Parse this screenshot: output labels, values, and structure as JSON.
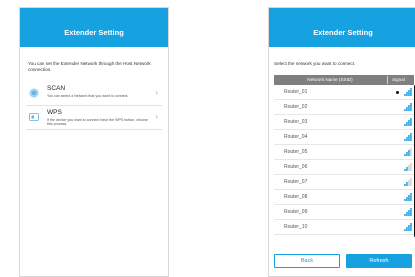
{
  "left_screen": {
    "title": "Extender Setting",
    "intro": "You can set the Extender Network through the Host Network connection.",
    "options": [
      {
        "title": "SCAN",
        "description": "You can select a Network that you want to connect.",
        "icon": "scan-icon"
      },
      {
        "title": "WPS",
        "description": "If the device you want to connect have the WPS button, choose this process.",
        "icon": "wps-icon"
      }
    ]
  },
  "right_screen": {
    "title": "Extender Setting",
    "prompt": "Select the network you want to connect.",
    "columns": {
      "name": "Network Name (SSID)",
      "signal": "Signal"
    },
    "networks": [
      {
        "ssid": "Router_01",
        "locked": true,
        "signal_strength": 4
      },
      {
        "ssid": "Router_02",
        "locked": false,
        "signal_strength": 4
      },
      {
        "ssid": "Router_03",
        "locked": false,
        "signal_strength": 4
      },
      {
        "ssid": "Router_04",
        "locked": false,
        "signal_strength": 4
      },
      {
        "ssid": "Router_05",
        "locked": false,
        "signal_strength": 3
      },
      {
        "ssid": "Router_06",
        "locked": false,
        "signal_strength": 2
      },
      {
        "ssid": "Router_07",
        "locked": false,
        "signal_strength": 2
      },
      {
        "ssid": "Router_08",
        "locked": false,
        "signal_strength": 4
      },
      {
        "ssid": "Router_09",
        "locked": false,
        "signal_strength": 4
      },
      {
        "ssid": "Router_10",
        "locked": false,
        "signal_strength": 4
      }
    ],
    "buttons": {
      "back": "Back",
      "refresh": "Refresh"
    }
  },
  "colors": {
    "accent": "#16a2e0",
    "signal_on": "#16a2e0",
    "signal_off": "#cfcfcf",
    "table_header": "#7f7f7f"
  }
}
